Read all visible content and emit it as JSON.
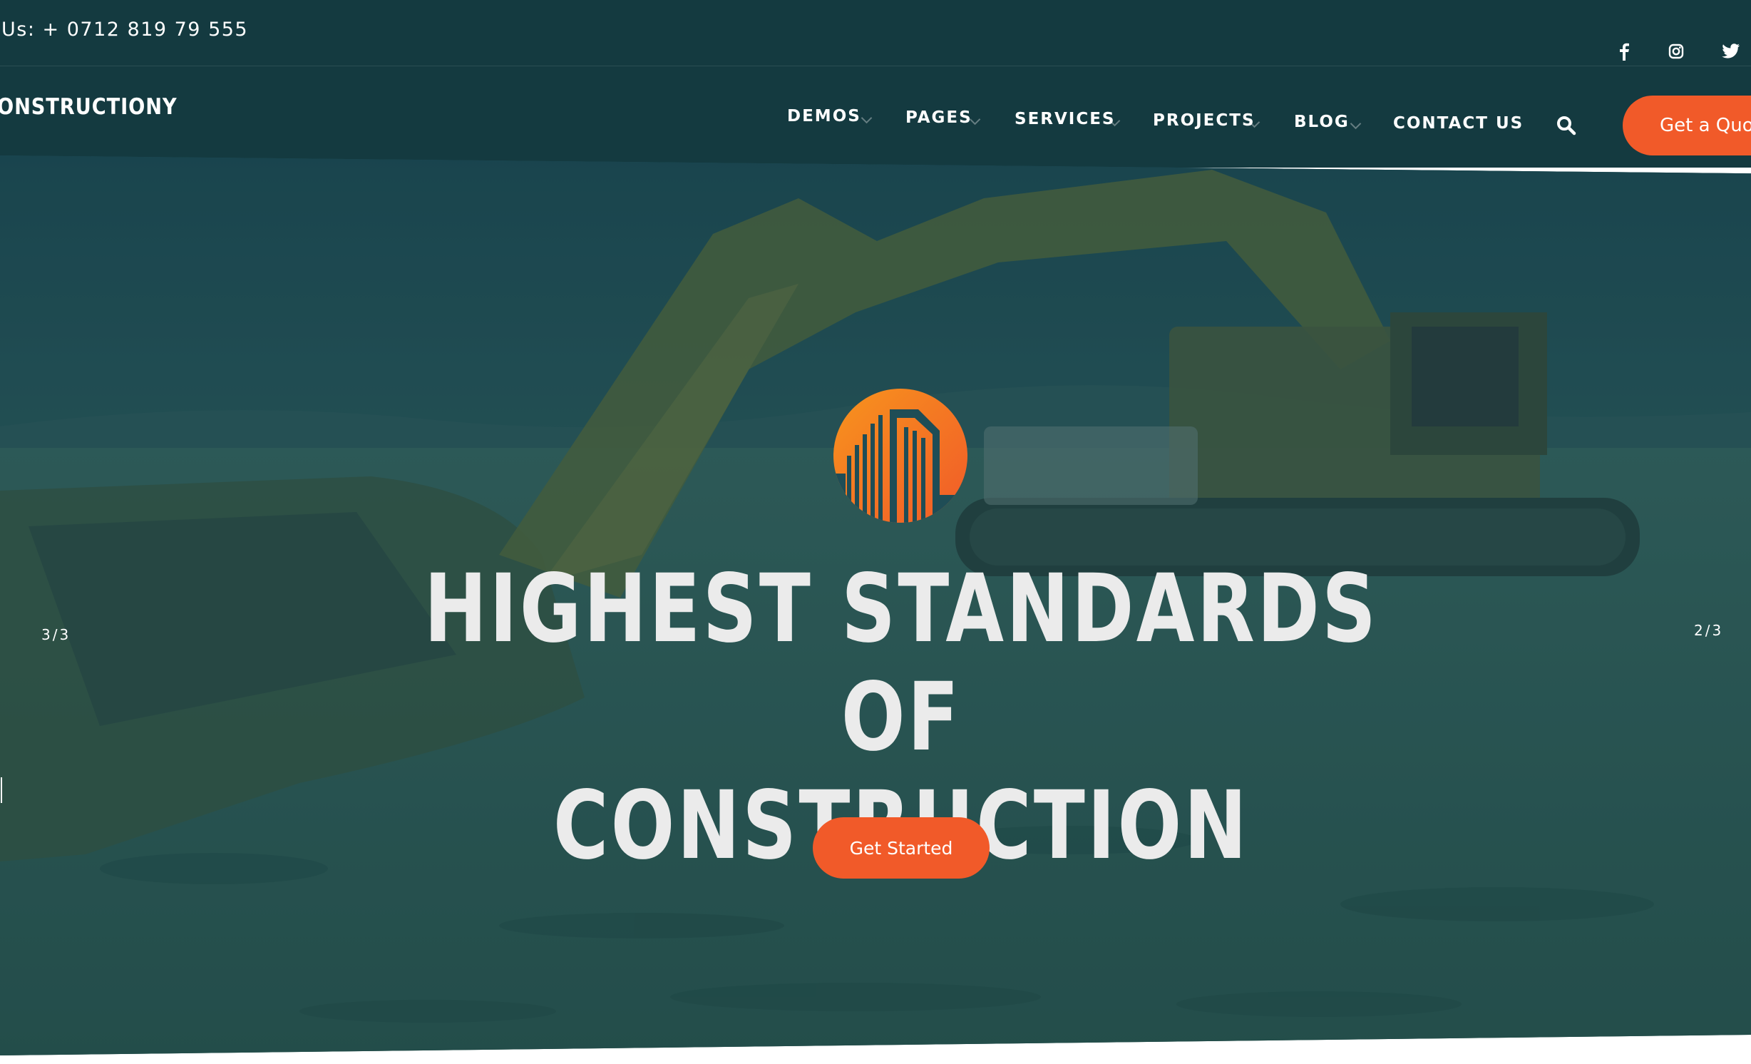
{
  "topbar": {
    "phone_text": "Us: + 0712 819 79 555",
    "social": [
      {
        "icon": "facebook-icon"
      },
      {
        "icon": "instagram-icon"
      },
      {
        "icon": "twitter-icon"
      }
    ]
  },
  "header": {
    "logo_text": "ONSTRUCTIONY",
    "nav": [
      {
        "label": "DEMOS",
        "has_dropdown": true
      },
      {
        "label": "PAGES",
        "has_dropdown": true
      },
      {
        "label": "SERVICES",
        "has_dropdown": true
      },
      {
        "label": "PROJECTS",
        "has_dropdown": true
      },
      {
        "label": "BLOG",
        "has_dropdown": true
      },
      {
        "label": "CONTACT US",
        "has_dropdown": false
      }
    ],
    "search_icon": "search-icon",
    "quote_button": "Get a Quote"
  },
  "hero": {
    "title_line1": "HIGHEST STANDARDS OF",
    "title_line2": "CONSTRUCTION",
    "cta_label": "Get Started",
    "prev_counter": "3/3",
    "next_counter": "2/3"
  },
  "colors": {
    "header_bg": "#143a40",
    "accent": "#f15a29",
    "hero_text": "#ebebeb"
  }
}
